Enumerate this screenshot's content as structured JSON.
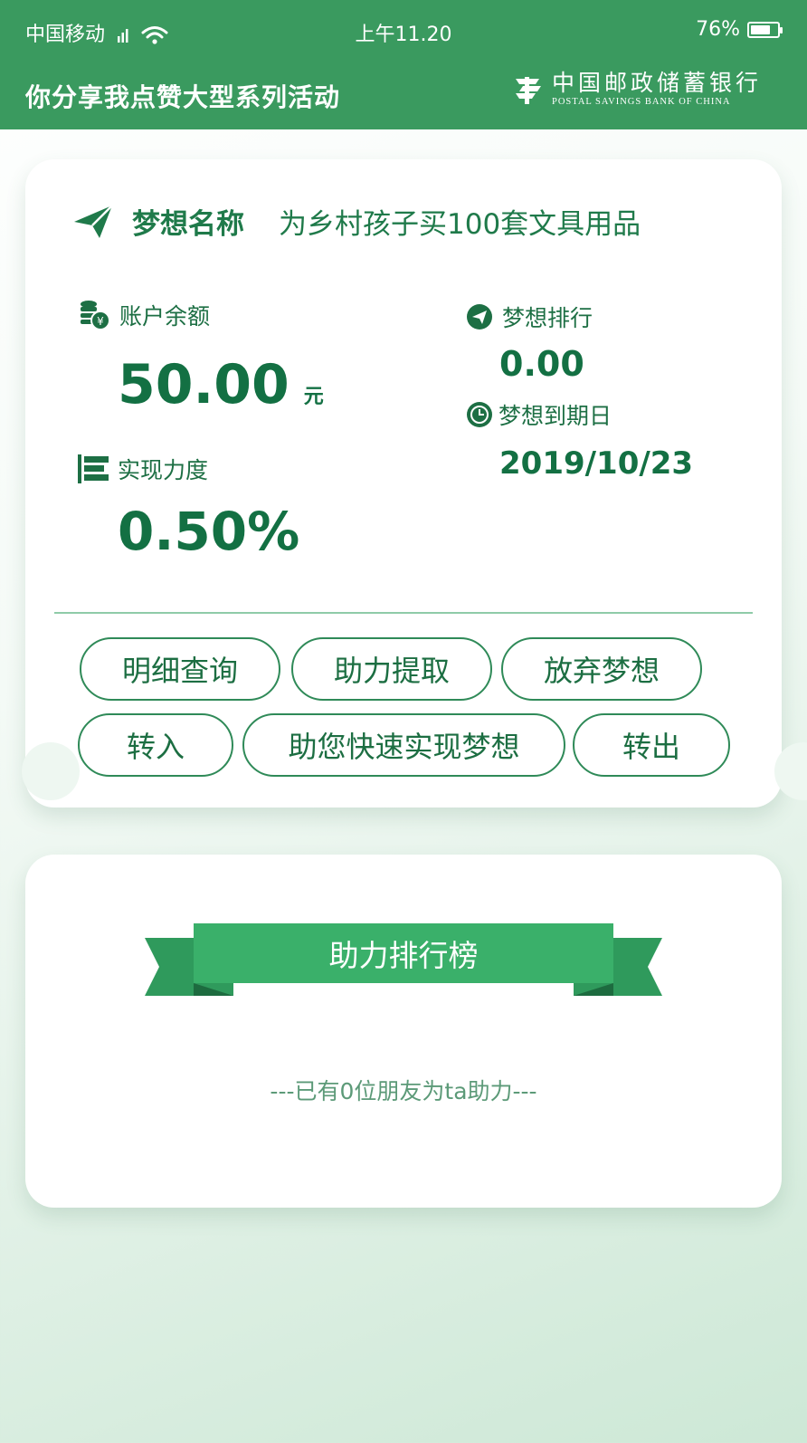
{
  "status": {
    "carrier": "中国移动",
    "time": "上午11.20",
    "battery": "76%",
    "battery_level": 0.76
  },
  "header": {
    "title": "你分享我点赞大型系列活动",
    "logo_cn": "中国邮政储蓄银行",
    "logo_en": "POSTAL SAVINGS BANK OF CHINA"
  },
  "dream": {
    "name_label": "梦想名称",
    "name_value": "为乡村孩子买100套文具用品",
    "balance_label": "账户余额",
    "balance_value": "50.00",
    "balance_unit": "元",
    "rank_label": "梦想排行",
    "rank_value": "0.00",
    "due_label": "梦想到期日",
    "due_value": "2019/10/23",
    "progress_label": "实现力度",
    "progress_value": "0.50%"
  },
  "buttons": {
    "detail": "明细查询",
    "withdraw": "助力提取",
    "abandon": "放弃梦想",
    "transfer_in": "转入",
    "quick": "助您快速实现梦想",
    "transfer_out": "转出"
  },
  "leaderboard": {
    "title": "助力排行榜",
    "friends_text": "---已有0位朋友为ta助力---"
  },
  "colors": {
    "brand_green": "#3a9a5f",
    "text_green": "#137043",
    "ribbon_green": "#3ab06a"
  }
}
